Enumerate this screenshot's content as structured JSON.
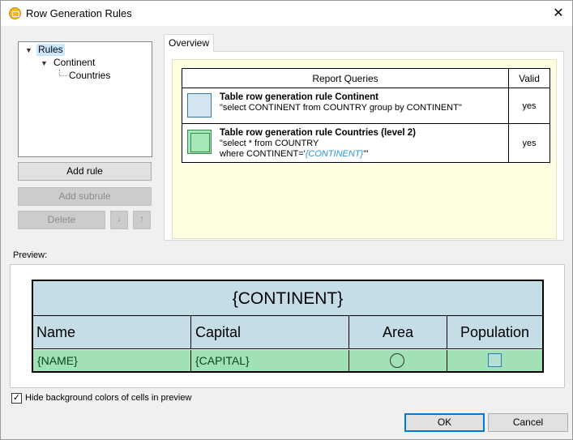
{
  "window": {
    "title": "Row Generation Rules",
    "close_glyph": "✕"
  },
  "tree": {
    "root": "Rules",
    "child": "Continent",
    "grandchild": "Countries",
    "toggle_glyph": "▼"
  },
  "buttons": {
    "add_rule": "Add rule",
    "add_subrule": "Add subrule",
    "delete": "Delete",
    "down_glyph": "↓",
    "up_glyph": "↑",
    "ok": "OK",
    "cancel": "Cancel"
  },
  "overview": {
    "tab": "Overview",
    "header_queries": "Report Queries",
    "header_valid": "Valid",
    "rows": [
      {
        "title": "Table row generation rule Continent",
        "query_line1": "\"select CONTINENT from COUNTRY group by CONTINENT\"",
        "valid": "yes"
      },
      {
        "title": "Table row generation rule Countries (level 2)",
        "query_line1": "\"select * from COUNTRY",
        "query_line2_prefix": "where CONTINENT='",
        "query_line2_var": "{CONTINENT}",
        "query_line2_suffix": "'\"",
        "valid": "yes"
      }
    ]
  },
  "preview": {
    "label": "Preview:",
    "heading": "{CONTINENT}",
    "columns": [
      "Name",
      "Capital",
      "Area",
      "Population"
    ],
    "cells": [
      "{NAME}",
      "{CAPITAL}"
    ]
  },
  "options": {
    "hide_bg_checked": true,
    "hide_bg_label": "Hide background colors of cells in preview",
    "check_glyph": "✓"
  },
  "colors": {
    "header_bg": "#c5dde7",
    "row_bg": "#a2e0b5",
    "overview_bg": "#ffffe1",
    "variable_text": "#2a96d8"
  }
}
